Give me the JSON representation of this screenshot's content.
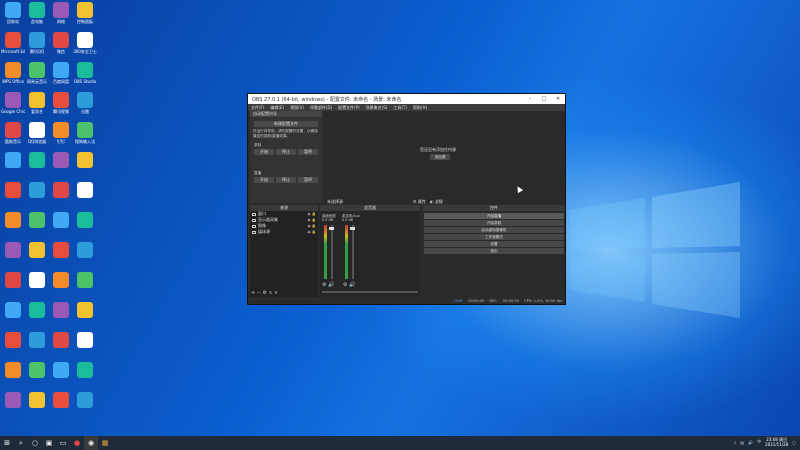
{
  "obs": {
    "title": "OBS 27.0.1 (64-bit, windows) - 配置文件: 未命名 - 场景: 未命名",
    "menu": [
      "文件(F)",
      "编辑(E)",
      "视图(V)",
      "停靠部件(D)",
      "配置文件(P)",
      "场景集合(S)",
      "工具(T)",
      "帮助(H)"
    ],
    "left_panel": {
      "header": "自动配置向导",
      "button_top": "新建配置文件",
      "description": "在运行向导前，请先配置好设置，以确保最佳的录制/直播效果。",
      "section1": "录制",
      "section2": "直播",
      "btn_start": "开始",
      "btn_stop": "停止",
      "btn_pause": "暂停"
    },
    "preview": {
      "message": "您还没有添加任何源",
      "add_button": "添加源"
    },
    "preview_status": "未选择源",
    "preview_props": "属性",
    "preview_filters": "滤镜",
    "docks": {
      "sources": "来源",
      "mixer": "混音器",
      "controls": "控件"
    },
    "sources": [
      {
        "name": "窗口"
      },
      {
        "name": "显示器采集"
      },
      {
        "name": "图像"
      },
      {
        "name": "媒体源"
      }
    ],
    "mixer_channels": [
      {
        "name": "桌面音频",
        "db": "0.0 dB"
      },
      {
        "name": "麦克风/Aux",
        "db": "0.0 dB"
      }
    ],
    "controls": [
      {
        "label": "开始直播"
      },
      {
        "label": "开始录制"
      },
      {
        "label": "启动虚拟摄像机"
      },
      {
        "label": "工作室模式"
      },
      {
        "label": "设置"
      },
      {
        "label": "退出"
      }
    ],
    "footer": {
      "live_label": "LIVE:",
      "live_time": "00:00:00",
      "rec_label": "REC:",
      "rec_time": "00:00:00",
      "cpu": "CPU: 1.4%, 30.00 fps"
    }
  },
  "taskbar": {
    "time": "23:08 周日",
    "date": "2021/11/28",
    "ime": "中"
  },
  "desktop_icons": [
    "回收站",
    "此电脑",
    "网络",
    "控制面板",
    "Microsoft Edge",
    "腾讯QQ",
    "微信",
    "360安全卫士",
    "WPS Office",
    "网易云音乐",
    "百度网盘",
    "OBS Studio",
    "Google Chrome",
    "爱奇艺",
    "腾讯视频",
    "迅雷",
    "酷狗音乐",
    "QQ浏览器",
    "钉钉",
    "搜狗输入法"
  ],
  "colors": {
    "wallpaper": "#0b5fd0",
    "obs_bg": "#2b2b2b",
    "taskbar": "#1f2a3a"
  }
}
